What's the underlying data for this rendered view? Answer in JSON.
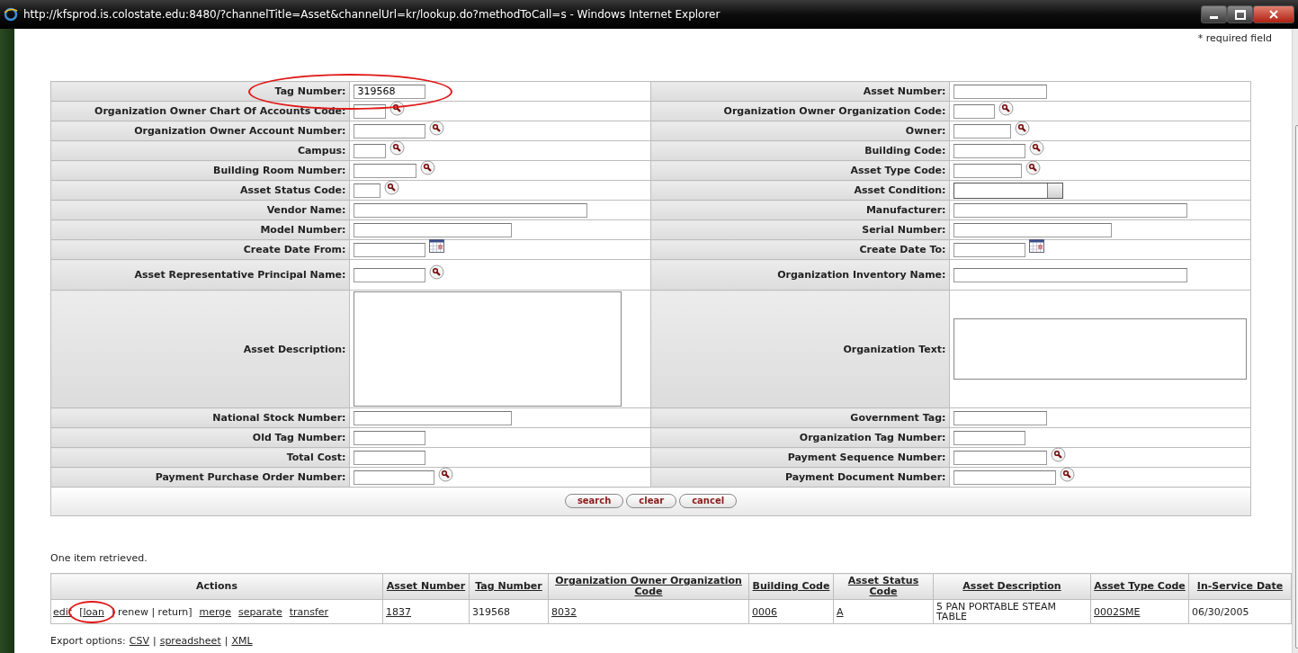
{
  "window": {
    "title": "http://kfsprod.is.colostate.edu:8480/?channelTitle=Asset&channelUrl=kr/lookup.do?methodToCall=s - Windows Internet Explorer"
  },
  "required_note": "* required field",
  "form": {
    "rows": [
      {
        "left": {
          "label": "Tag Number:",
          "kind": "text",
          "value": "319568",
          "circled": true
        },
        "right": {
          "label": "Asset Number:",
          "kind": "text",
          "circled": false
        }
      },
      {
        "left": {
          "label": "Organization Owner Chart Of Accounts Code:",
          "kind": "lookup",
          "circled": false
        },
        "right": {
          "label": "Organization Owner Organization Code:",
          "kind": "lookup",
          "circled": false
        }
      },
      {
        "left": {
          "label": "Organization Owner Account Number:",
          "kind": "lookup",
          "circled": false
        },
        "right": {
          "label": "Owner:",
          "kind": "lookup",
          "circled": false
        }
      },
      {
        "left": {
          "label": "Campus:",
          "kind": "lookup",
          "circled": false
        },
        "right": {
          "label": "Building Code:",
          "kind": "lookup",
          "circled": false
        }
      },
      {
        "left": {
          "label": "Building Room Number:",
          "kind": "lookup",
          "circled": false
        },
        "right": {
          "label": "Asset Type Code:",
          "kind": "lookup",
          "circled": false
        }
      },
      {
        "left": {
          "label": "Asset Status Code:",
          "kind": "lookup",
          "circled": false
        },
        "right": {
          "label": "Asset Condition:",
          "kind": "select",
          "circled": false
        }
      },
      {
        "left": {
          "label": "Vendor Name:",
          "kind": "text",
          "circled": false
        },
        "right": {
          "label": "Manufacturer:",
          "kind": "text",
          "circled": false
        }
      },
      {
        "left": {
          "label": "Model Number:",
          "kind": "text",
          "circled": false
        },
        "right": {
          "label": "Serial Number:",
          "kind": "text",
          "circled": false
        }
      },
      {
        "left": {
          "label": "Create Date From:",
          "kind": "date",
          "circled": false
        },
        "right": {
          "label": "Create Date To:",
          "kind": "date",
          "circled": false
        }
      },
      {
        "left": {
          "label": "Asset Representative Principal Name:",
          "kind": "lookup",
          "circled": false
        },
        "right": {
          "label": "Organization Inventory Name:",
          "kind": "text",
          "circled": false
        }
      },
      {
        "left": {
          "label": "Asset Description:",
          "kind": "textarea",
          "circled": false
        },
        "right": {
          "label": "Organization Text:",
          "kind": "textarea",
          "circled": false
        }
      },
      {
        "left": {
          "label": "National Stock Number:",
          "kind": "text",
          "circled": false
        },
        "right": {
          "label": "Government Tag:",
          "kind": "text",
          "circled": false
        }
      },
      {
        "left": {
          "label": "Old Tag Number:",
          "kind": "text",
          "circled": false
        },
        "right": {
          "label": "Organization Tag Number:",
          "kind": "text",
          "circled": false
        }
      },
      {
        "left": {
          "label": "Total Cost:",
          "kind": "text",
          "circled": false
        },
        "right": {
          "label": "Payment Sequence Number:",
          "kind": "lookup",
          "circled": false
        }
      },
      {
        "left": {
          "label": "Payment Purchase Order Number:",
          "kind": "lookup",
          "circled": false
        },
        "right": {
          "label": "Payment Document Number:",
          "kind": "lookup",
          "circled": false
        }
      }
    ],
    "buttons": [
      "search",
      "clear",
      "cancel"
    ]
  },
  "results": {
    "message": "One item retrieved.",
    "columns": [
      "Actions",
      "Asset Number",
      "Tag Number",
      "Organization Owner Organization Code",
      "Building Code",
      "Asset Status Code",
      "Asset Description",
      "Asset Type Code",
      "In-Service Date"
    ],
    "rows": [
      {
        "cells": [
          {
            "actions": [
              {
                "text": "edit",
                "link": true,
                "circled": false
              },
              {
                "text": "[loan",
                "link": true,
                "circled": true
              },
              {
                "text": "| renew | return]",
                "link": false,
                "circled": false
              },
              {
                "text": "merge",
                "link": true,
                "circled": false
              },
              {
                "text": "separate",
                "link": true,
                "circled": false
              },
              {
                "text": "transfer",
                "link": true,
                "circled": false
              }
            ]
          },
          {
            "text": "1837",
            "link": true
          },
          {
            "text": "319568",
            "link": false
          },
          {
            "text": "8032",
            "link": true
          },
          {
            "text": "0006",
            "link": true
          },
          {
            "text": "A",
            "link": true
          },
          {
            "text": "5 PAN PORTABLE STEAM TABLE",
            "link": false
          },
          {
            "text": "0002SME",
            "link": true
          },
          {
            "text": "06/30/2005",
            "link": false
          }
        ]
      }
    ]
  },
  "export": {
    "label": "Export options:",
    "items": [
      {
        "text": "CSV",
        "kind": "link"
      },
      {
        "text": "|",
        "kind": "separator"
      },
      {
        "text": "spreadsheet",
        "kind": "link"
      },
      {
        "text": "|",
        "kind": "separator"
      },
      {
        "text": "XML",
        "kind": "link"
      }
    ]
  }
}
